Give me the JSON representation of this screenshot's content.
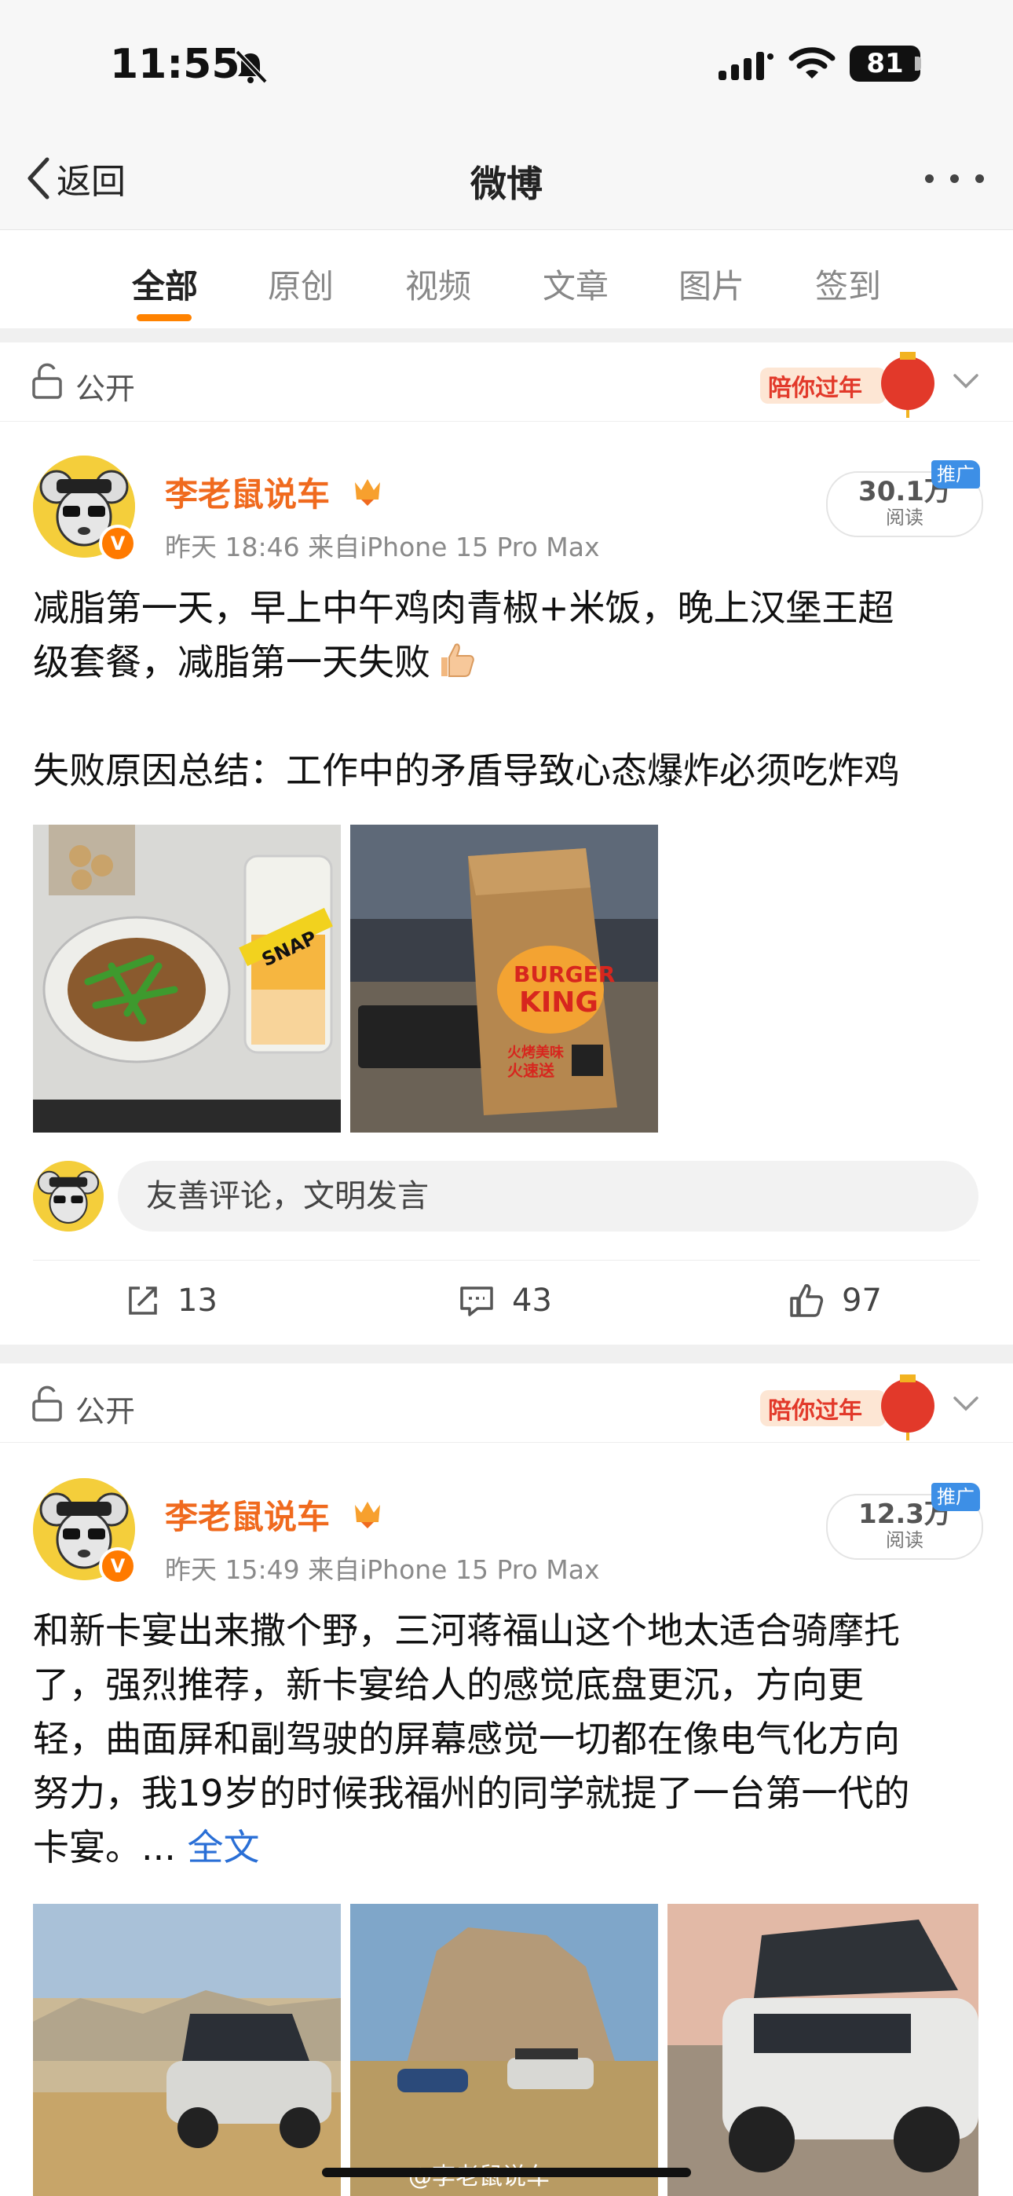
{
  "status_bar": {
    "time": "11:55",
    "battery": "81"
  },
  "nav": {
    "back_label": "返回",
    "title": "微博"
  },
  "tabs": [
    "全部",
    "原创",
    "视频",
    "文章",
    "图片",
    "签到"
  ],
  "active_tab": "全部",
  "festival_label": "陪你过年",
  "posts": [
    {
      "visibility": "公开",
      "username": "李老鼠说车",
      "meta": "昨天 18:46  来自iPhone 15 Pro Max",
      "reads": "30.1万",
      "reads_label": "阅读",
      "ad_badge": "推广",
      "text_line1": "减脂第一天，早上中午鸡肉青椒+米饭，晚上汉堡王超",
      "text_line2": "级套餐，减脂第一天失败",
      "text_line3": "失败原因总结：工作中的矛盾导致心态爆炸必须吃炸鸡",
      "image_text_1": "SNAP",
      "image_text_2a": "BURGER",
      "image_text_2b": "KING",
      "image_text_2c": "火烤美味",
      "image_text_2d": "火速送",
      "comment_placeholder": "友善评论，文明发言",
      "reposts": "13",
      "comments": "43",
      "likes": "97"
    },
    {
      "visibility": "公开",
      "username": "李老鼠说车",
      "meta": "昨天 15:49  来自iPhone 15 Pro Max",
      "reads": "12.3万",
      "reads_label": "阅读",
      "ad_badge": "推广",
      "text_line1": "和新卡宴出来撒个野，三河蒋福山这个地太适合骑摩托",
      "text_line2": "了，强烈推荐，新卡宴给人的感觉底盘更沉，方向更",
      "text_line3": "轻，曲面屏和副驾驶的屏幕感觉一切都在像电气化方向",
      "text_line4": "努力，我19岁的时候我福州的同学就提了一台第一代的",
      "text_line5": "卡宴。... ",
      "full_text_link": "全文"
    }
  ],
  "watermark": "@李老鼠说车",
  "colors": {
    "accent": "#ff8200",
    "username": "#f06a1e",
    "link": "#2a6fd6",
    "ad_badge": "#3d8fe6"
  }
}
